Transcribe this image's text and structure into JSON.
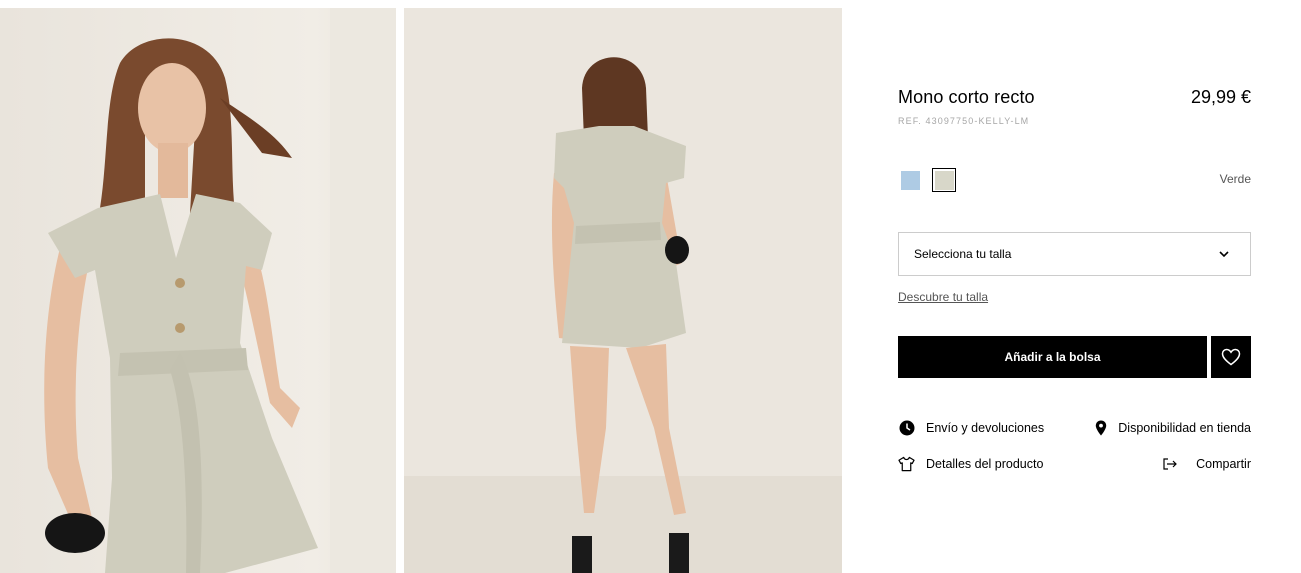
{
  "gallery": {
    "images": [
      {
        "alt": "front-view"
      },
      {
        "alt": "back-view"
      }
    ]
  },
  "product": {
    "title": "Mono corto recto",
    "price": "29,99 €",
    "reference": "REF. 43097750-KELLY-LM"
  },
  "colors": {
    "swatches": [
      {
        "name": "light-blue",
        "hex": "#aecbe4",
        "selected": false
      },
      {
        "name": "verde",
        "hex": "#d8d7c9",
        "selected": true
      }
    ],
    "selected_label": "Verde"
  },
  "size": {
    "select_label": "Selecciona tu talla",
    "guide_link": "Descubre tu talla"
  },
  "actions": {
    "add_to_bag": "Añadir a la bolsa",
    "favorite_icon": "heart-icon"
  },
  "links": {
    "shipping": {
      "label": "Envío y devoluciones",
      "icon": "clock-icon"
    },
    "store": {
      "label": "Disponibilidad en tienda",
      "icon": "location-pin-icon"
    },
    "details": {
      "label": "Detalles del producto",
      "icon": "tshirt-icon"
    },
    "share": {
      "label": "Compartir",
      "icon": "share-arrow-icon"
    }
  },
  "theme": {
    "primary": "#000000",
    "muted_text": "#555555",
    "ref_text": "#a6a6a6",
    "border": "#cccccc",
    "garment": "#cfcdbd"
  }
}
